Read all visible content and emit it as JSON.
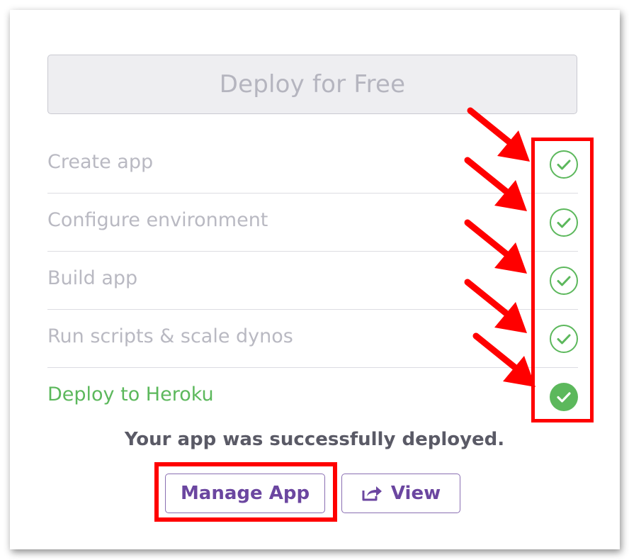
{
  "deploy_button": {
    "label": "Deploy for Free"
  },
  "steps": [
    {
      "label": "Create app",
      "status": "complete"
    },
    {
      "label": "Configure environment",
      "status": "complete"
    },
    {
      "label": "Build app",
      "status": "complete"
    },
    {
      "label": "Run scripts & scale dynos",
      "status": "complete"
    },
    {
      "label": "Deploy to Heroku",
      "status": "complete-final"
    }
  ],
  "status_message": "Your app was successfully deployed.",
  "actions": {
    "manage_label": "Manage App",
    "view_label": "View",
    "view_icon": "external-link-icon"
  },
  "colors": {
    "success_green": "#5cb85c",
    "accent_purple": "#6b46a0",
    "annotation_red": "#ff0000"
  }
}
